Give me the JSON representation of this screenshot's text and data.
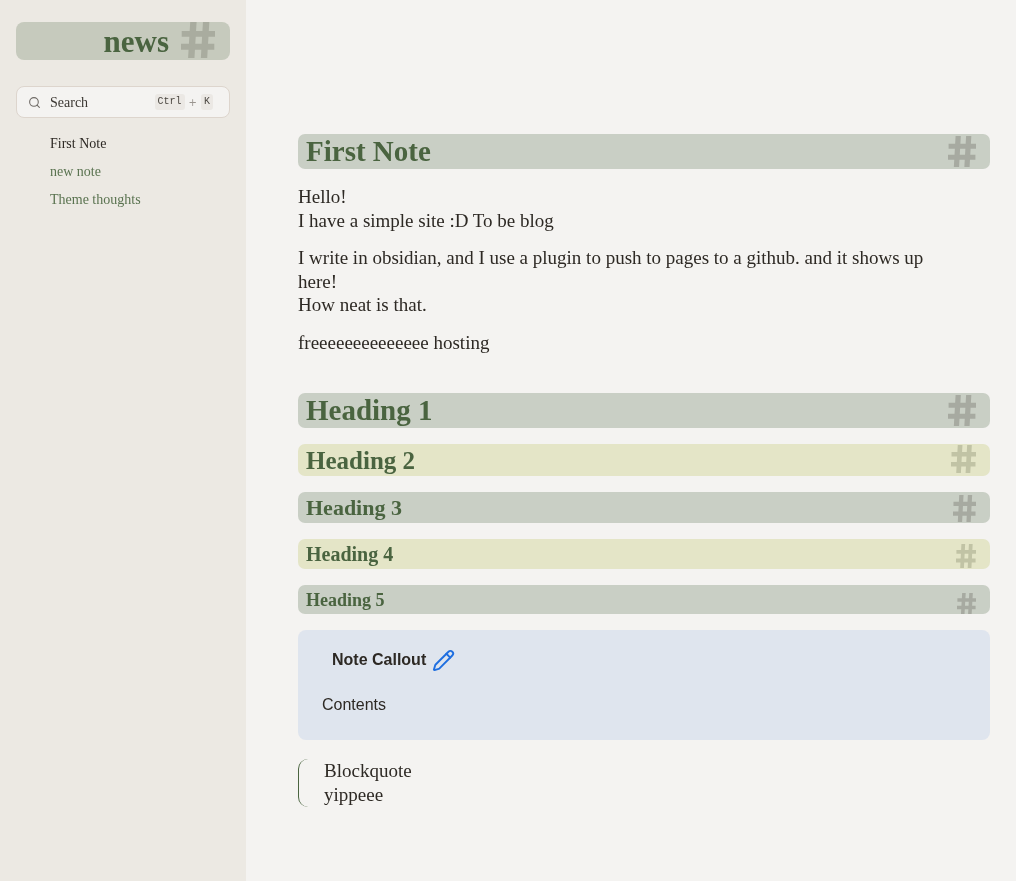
{
  "sidebar": {
    "title": "news",
    "search": {
      "placeholder": "Search",
      "keys": [
        "Ctrl",
        "K"
      ],
      "joiner": "+"
    },
    "items": [
      {
        "label": "First Note",
        "selected": true
      },
      {
        "label": "new note",
        "selected": false
      },
      {
        "label": "Theme thoughts",
        "selected": false
      }
    ]
  },
  "article": {
    "title": "First Note",
    "blocks": [
      {
        "kind": "paragraph",
        "lines": [
          "Hello!",
          "I have a simple site :D To be blog"
        ]
      },
      {
        "kind": "paragraph",
        "lines": [
          "I write in obsidian, and I use a plugin to push to pages to a github. and it shows up here!",
          "How neat is that."
        ]
      },
      {
        "kind": "paragraph",
        "lines": [
          "freeeeeeeeeeeeee hosting"
        ]
      },
      {
        "kind": "h1",
        "text": "Heading 1"
      },
      {
        "kind": "h2",
        "text": "Heading 2"
      },
      {
        "kind": "h3",
        "text": "Heading 3"
      },
      {
        "kind": "h4",
        "text": "Heading 4"
      },
      {
        "kind": "h5",
        "text": "Heading 5"
      },
      {
        "kind": "callout",
        "title": "Note Callout",
        "text": "Contents"
      },
      {
        "kind": "quote",
        "lines": [
          "Blockquote",
          "yippeee"
        ]
      }
    ]
  }
}
